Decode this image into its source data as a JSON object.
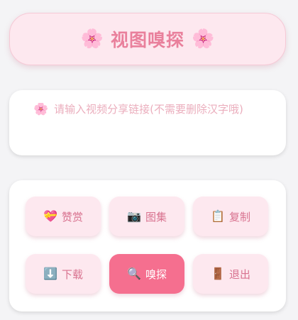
{
  "header": {
    "title": "视图嗅探",
    "flower_icon": "🌸"
  },
  "link_input": {
    "flower_icon": "🌸",
    "placeholder": "请输入视频分享链接(不需要删除汉字哦)",
    "value": ""
  },
  "buttons": [
    {
      "id": "reward",
      "icon": "💝",
      "label": "赞赏"
    },
    {
      "id": "gallery",
      "icon": "📷",
      "label": "图集"
    },
    {
      "id": "copy",
      "icon": "📋",
      "label": "复制"
    },
    {
      "id": "download",
      "icon": "⬇️",
      "label": "下载"
    },
    {
      "id": "sniff",
      "icon": "🔍",
      "label": "嗅探"
    },
    {
      "id": "exit",
      "icon": "🚪",
      "label": "退出"
    }
  ],
  "colors": {
    "accent": "#f56f8f",
    "pink_light": "#fde8ef",
    "pink_text": "#d8728f",
    "title_text": "#e9809c",
    "background": "#f4f4f6"
  }
}
